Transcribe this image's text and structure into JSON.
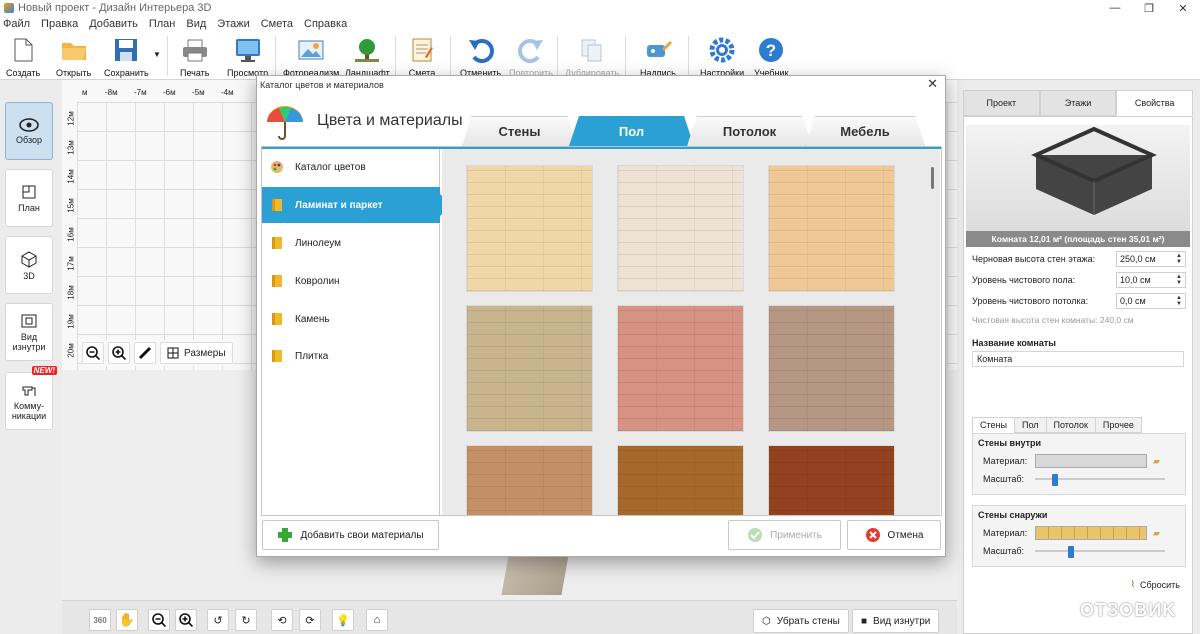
{
  "app": {
    "title": "Новый проект - Дизайн Интерьера 3D"
  },
  "menu": [
    "Файл",
    "Правка",
    "Добавить",
    "План",
    "Вид",
    "Этажи",
    "Смета",
    "Справка"
  ],
  "toolbar": {
    "create": "Создать",
    "open": "Открыть",
    "save": "Сохранить",
    "print": "Печать",
    "preview": "Просмотр",
    "photo": "Фотореализм",
    "landscape": "Ландшафт",
    "estimate": "Смета",
    "undo": "Отменить",
    "redo": "Повторить",
    "duplicate": "Дублировать",
    "label": "Надпись",
    "settings": "Настройки",
    "tutorial": "Учебник"
  },
  "left": {
    "overview": "Обзор",
    "plan": "План",
    "view3d": "3D",
    "inside": "Вид изнутри",
    "comm": "Комму-никации",
    "new": "NEW!"
  },
  "ruler": {
    "top": [
      "-8м",
      "-7м",
      "-6м",
      "-5м",
      "-4м"
    ],
    "left": [
      "12м",
      "13м",
      "14м",
      "15м",
      "16м",
      "17м",
      "18м",
      "19м",
      "20м"
    ]
  },
  "plan_tools": {
    "sizes": "Размеры"
  },
  "bottom": {
    "remove_walls": "Убрать стены",
    "view_inside": "Вид изнутри",
    "badge360": "360"
  },
  "right": {
    "tabs": [
      "Проект",
      "Этажи",
      "Свойства"
    ],
    "room_caption": "Комната 12,01 м²  (площадь стен 35,01 м²)",
    "props": [
      {
        "label": "Черновая высота стен этажа:",
        "value": "250,0 см"
      },
      {
        "label": "Уровень чистового пола:",
        "value": "10,0 см"
      },
      {
        "label": "Уровень чистового потолка:",
        "value": "0,0 см"
      }
    ],
    "clean_height": "Чистовая высота стен комнаты: 240,0 см",
    "room_name_title": "Название комнаты",
    "room_name": "Комната",
    "subtabs": [
      "Стены",
      "Пол",
      "Потолок",
      "Прочее"
    ],
    "walls_in": "Стены внутри",
    "walls_out": "Стены снаружи",
    "material": "Материал:",
    "scale": "Масштаб:",
    "scale_in": 0.14,
    "scale_out": 0.27,
    "reset": "Сбросить"
  },
  "dialog": {
    "title": "Каталог цветов и материалов",
    "heading": "Цвета и материалы",
    "tabs": [
      "Стены",
      "Пол",
      "Потолок",
      "Мебель"
    ],
    "categories": [
      "Каталог цветов",
      "Ламинат и паркет",
      "Линолеум",
      "Ковролин",
      "Камень",
      "Плитка"
    ],
    "add": "Добавить свои материалы",
    "apply": "Применить",
    "cancel": "Отмена"
  },
  "colors": {
    "accent": "#2aa0d5",
    "tiles": [
      "#f1d7a7",
      "#ede2d4",
      "#efc895",
      "#c9b58d",
      "#d69282",
      "#b59784",
      "#c48f62",
      "#a56a2b",
      "#93411f"
    ]
  },
  "watermark": "OTЗOВИK"
}
